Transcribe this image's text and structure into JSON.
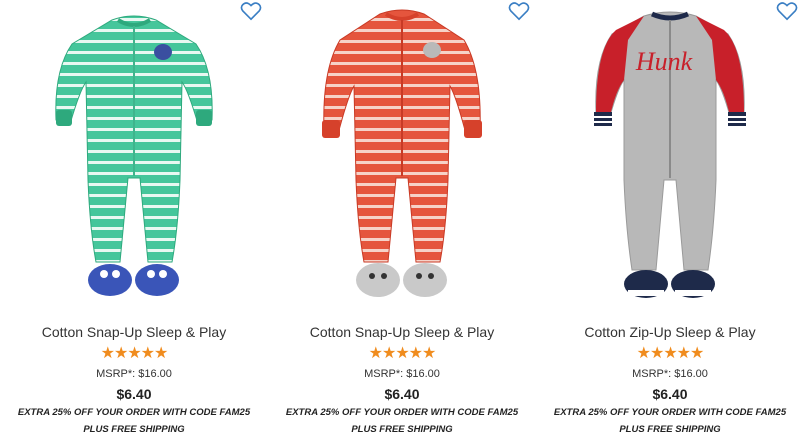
{
  "accent": "#3b7fc4",
  "star_color": "#f08c1e",
  "products": [
    {
      "name": "Cotton Snap-Up Sleep & Play",
      "rating": 5,
      "msrp": "MSRP*: $16.00",
      "price": "$6.40",
      "promo_line1": "EXTRA 25% OFF YOUR ORDER WITH CODE FAM25",
      "promo_line2": "PLUS FREE SHIPPING",
      "image": "green-white-striped-sleeper-with-monster-feet",
      "wishlist_icon": "heart-outline-icon"
    },
    {
      "name": "Cotton Snap-Up Sleep & Play",
      "rating": 5,
      "msrp": "MSRP*: $16.00",
      "price": "$6.40",
      "promo_line1": "EXTRA 25% OFF YOUR ORDER WITH CODE FAM25",
      "promo_line2": "PLUS FREE SHIPPING",
      "image": "red-white-striped-sleeper-with-dog-feet",
      "wishlist_icon": "heart-outline-icon"
    },
    {
      "name": "Cotton Zip-Up Sleep & Play",
      "rating": 5,
      "msrp": "MSRP*: $16.00",
      "price": "$6.40",
      "promo_line1": "EXTRA 25% OFF YOUR ORDER WITH CODE FAM25",
      "promo_line2": "PLUS FREE SHIPPING",
      "image": "gray-red-hunk-zip-sleeper-with-sneaker-feet",
      "wishlist_icon": "heart-outline-icon"
    }
  ]
}
